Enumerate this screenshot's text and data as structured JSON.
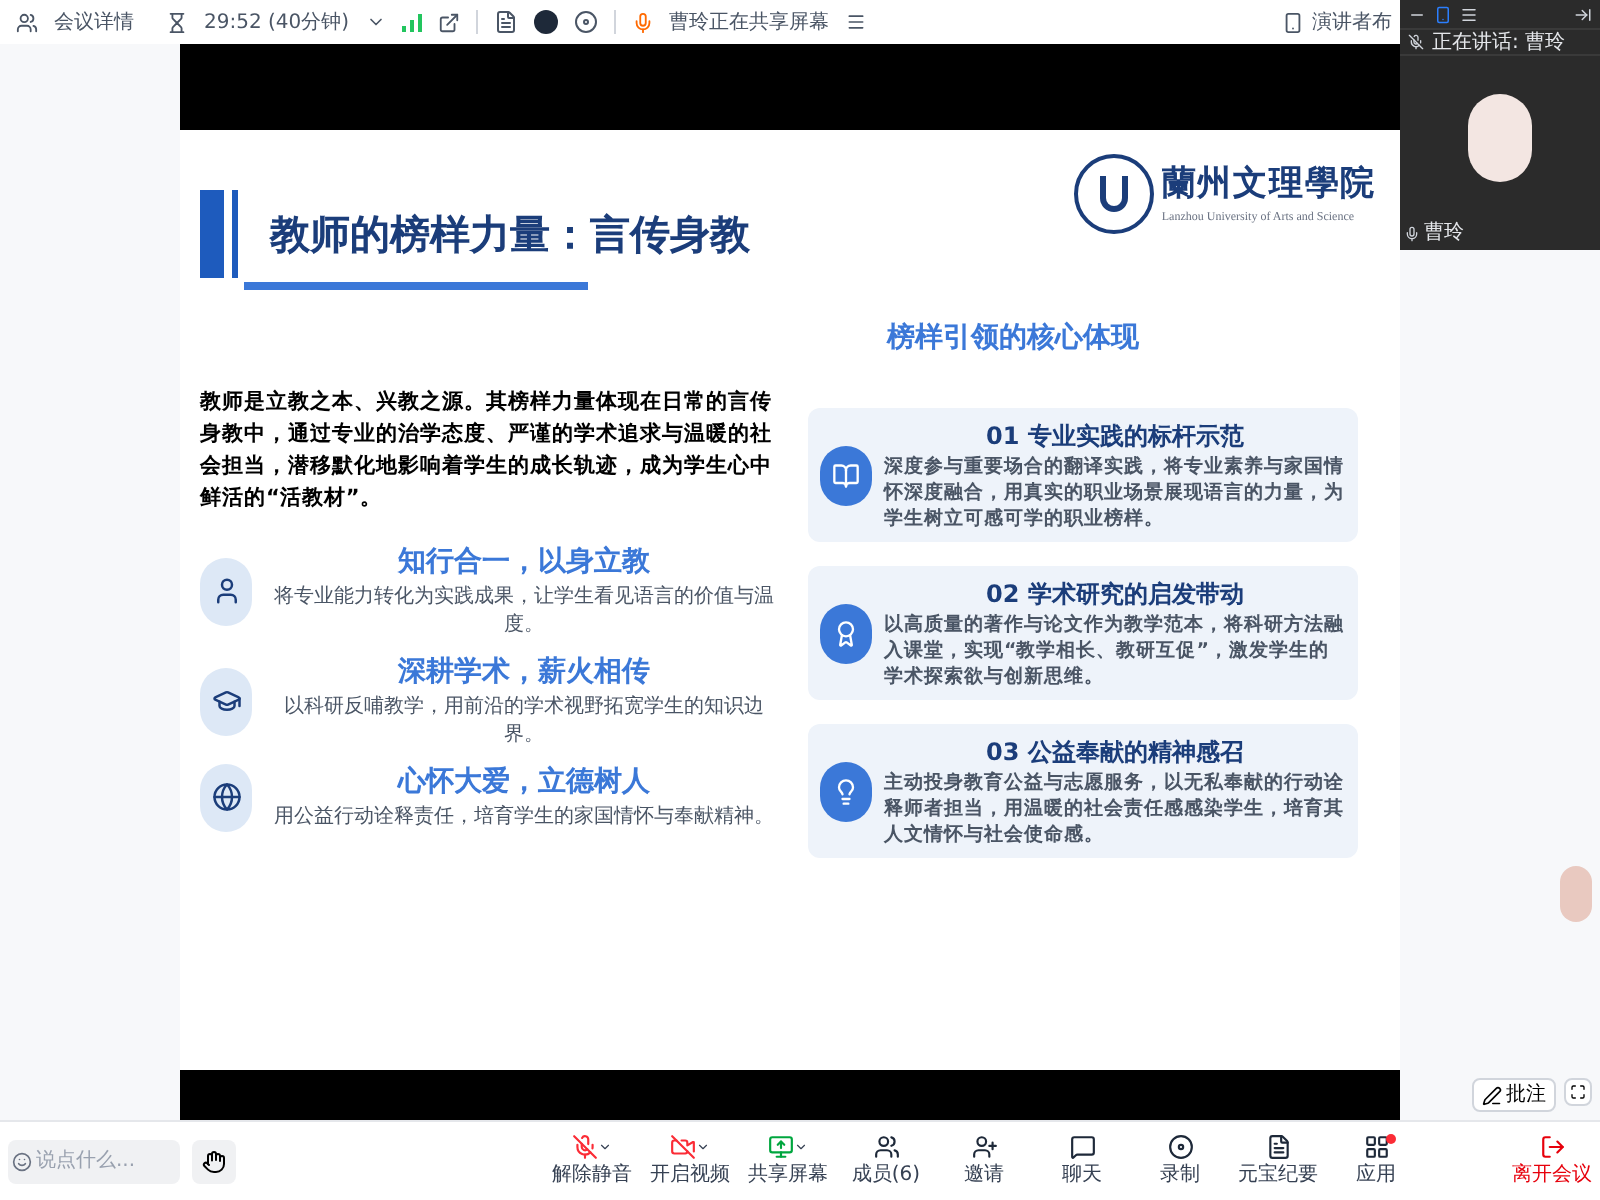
{
  "top_bar": {
    "meeting_info": "会议详情",
    "timer": "29:52 (40分钟)",
    "sharing_notice": "曹玲正在共享屏幕",
    "view_button": "演讲者布"
  },
  "speaker_panel": {
    "speaking_label": "正在讲话: 曹玲",
    "name": "曹玲"
  },
  "slide": {
    "title": "教师的榜样力量：言传身教",
    "logo_name": "蘭州文理學院",
    "logo_english": "Lanzhou University of Arts and Science",
    "intro": "教师是立教之本、兴教之源。其榜样力量体现在日常的言传身教中，通过专业的治学态度、严谨的学术追求与温暖的社会担当，潜移默化地影响着学生的成长轨迹，成为学生心中鲜活的“活教材”。",
    "points": [
      {
        "kind": "person",
        "heading": "知行合一，以身立教",
        "text": "将专业能力转化为实践成果，让学生看见语言的价值与温度。"
      },
      {
        "kind": "graduation",
        "heading": "深耕学术，薪火相传",
        "text": "以科研反哺教学，用前沿的学术视野拓宽学生的知识边界。"
      },
      {
        "kind": "globe",
        "heading": "心怀大爱，立德树人",
        "text": "用公益行动诠释责任，培育学生的家国情怀与奉献精神。"
      }
    ],
    "core_title": "榜样引领的核心体现",
    "cards": [
      {
        "kind": "book",
        "heading": "01 专业实践的标杆示范",
        "text": "深度参与重要场合的翻译实践，将专业素养与家国情怀深度融合，用真实的职业场景展现语言的力量，为学生树立可感可学的职业榜样。"
      },
      {
        "kind": "award",
        "heading": "02 学术研究的启发带动",
        "text": "以高质量的著作与论文作为教学范本，将科研方法融入课堂，实现“教学相长、教研互促”，激发学生的学术探索欲与创新思维。"
      },
      {
        "kind": "bulb",
        "heading": "03 公益奉献的精神感召",
        "text": "主动投身教育公益与志愿服务，以无私奉献的行动诠释师者担当，用温暖的社会责任感感染学生，培育其人文情怀与社会使命感。"
      }
    ]
  },
  "annotate_button": "批注",
  "chat_input": {
    "placeholder": "说点什么..."
  },
  "toolbar": [
    {
      "kind": "mic_off",
      "label": "解除静音",
      "menu": true,
      "badge": false
    },
    {
      "kind": "video_off",
      "label": "开启视频",
      "menu": true,
      "badge": false
    },
    {
      "kind": "share",
      "label": "共享屏幕",
      "menu": true,
      "badge": false
    },
    {
      "kind": "members",
      "label": "成员(6)",
      "menu": false,
      "badge": false
    },
    {
      "kind": "invite",
      "label": "邀请",
      "menu": false,
      "badge": false
    },
    {
      "kind": "chat",
      "label": "聊天",
      "menu": false,
      "badge": false
    },
    {
      "kind": "record",
      "label": "录制",
      "menu": false,
      "badge": false
    },
    {
      "kind": "notes",
      "label": "元宝纪要",
      "menu": false,
      "badge": false
    },
    {
      "kind": "apps",
      "label": "应用",
      "menu": false,
      "badge": true
    }
  ],
  "leave_button": "离开会议"
}
